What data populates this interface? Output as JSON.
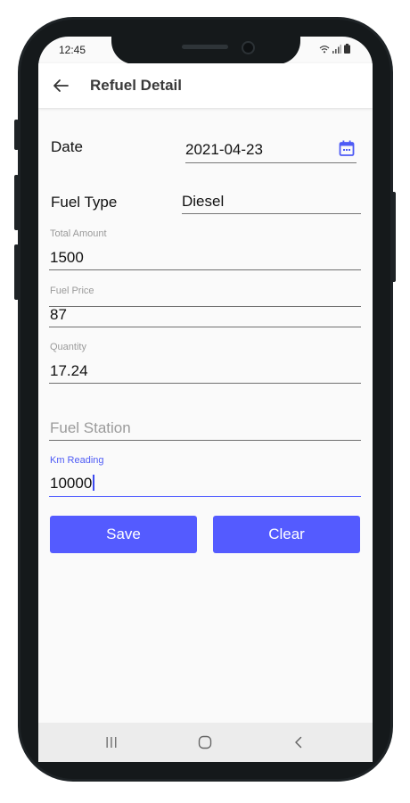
{
  "status_bar": {
    "time": "12:45",
    "icons": [
      "wifi-icon",
      "signal-icon",
      "battery-icon"
    ]
  },
  "app_bar": {
    "title": "Refuel Detail",
    "back_icon": "arrow-left-icon"
  },
  "form": {
    "date": {
      "label": "Date",
      "value": "2021-04-23",
      "icon": "calendar-icon"
    },
    "fuel_type": {
      "label": "Fuel Type",
      "value": "Diesel"
    },
    "total_amount": {
      "label": "Total Amount",
      "value": "1500"
    },
    "fuel_price": {
      "label": "Fuel Price",
      "value": "87"
    },
    "quantity": {
      "label": "Quantity",
      "value": "17.24"
    },
    "fuel_station": {
      "placeholder": "Fuel Station",
      "value": ""
    },
    "km_reading": {
      "label": "Km Reading",
      "value": "10000"
    }
  },
  "buttons": {
    "save": "Save",
    "clear": "Clear"
  },
  "nav_bar": {
    "icons": [
      "recent-apps-icon",
      "home-icon",
      "back-nav-icon"
    ]
  },
  "colors": {
    "accent": "#545bff",
    "app_background": "#fafafa",
    "phone_frame": "#1e2326",
    "nav_bar": "#ececec"
  }
}
